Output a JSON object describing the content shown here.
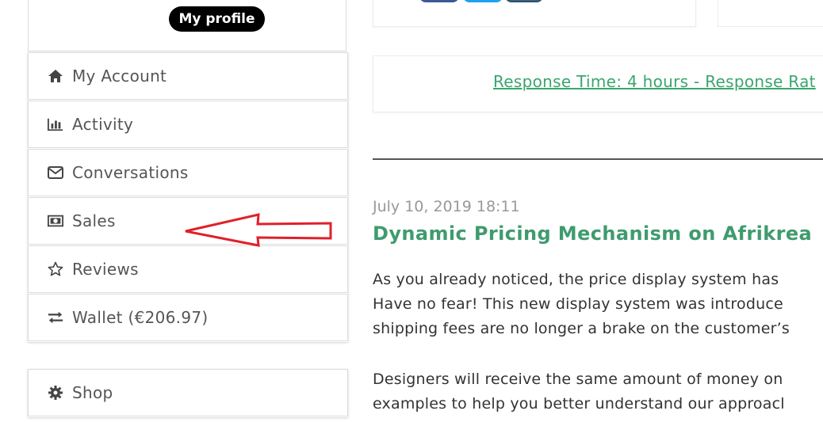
{
  "sidebar": {
    "profile_label": "My profile",
    "menu": [
      {
        "label": "My Account",
        "icon": "home-icon"
      },
      {
        "label": "Activity",
        "icon": "bar-chart-icon"
      },
      {
        "label": "Conversations",
        "icon": "envelope-icon"
      },
      {
        "label": "Sales",
        "icon": "money-icon"
      },
      {
        "label": "Reviews",
        "icon": "star-icon"
      },
      {
        "label": "Wallet (€206.97)",
        "icon": "exchange-icon"
      }
    ],
    "menu2": [
      {
        "label": "Shop",
        "icon": "gear-icon"
      }
    ]
  },
  "main": {
    "response_link": "Response Time: 4 hours  - Response Rat",
    "post": {
      "date": "July 10, 2019 18:11",
      "title": "Dynamic Pricing Mechanism on Afrikrea",
      "para1": [
        "As you already noticed, the price display system has",
        "Have no fear! This new display system was introduce",
        "shipping fees are no longer a brake on the customer’s"
      ],
      "para2": [
        "Designers will receive the same amount of money on",
        "examples to help you better understand our approacl"
      ]
    }
  },
  "colors": {
    "accent_green": "#3aa56e",
    "title_green": "#3f9b6e",
    "annotation_red": "#e0202a"
  }
}
